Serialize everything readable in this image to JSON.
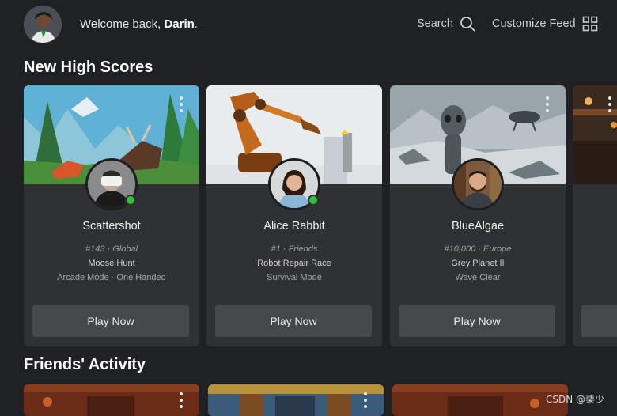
{
  "header": {
    "welcome_prefix": "Welcome back, ",
    "user_name": "Darin",
    "welcome_suffix": ".",
    "search_label": "Search",
    "customize_label": "Customize Feed"
  },
  "sections": {
    "high_scores_title": "New High Scores",
    "friends_activity_title": "Friends' Activity"
  },
  "cards": [
    {
      "player": "Scattershot",
      "rank": "#143 · Global",
      "game": "Moose Hunt",
      "mode": "Arcade Mode · One Handed",
      "button": "Play Now",
      "online": true
    },
    {
      "player": "Alice Rabbit",
      "rank": "#1 · Friends",
      "game": "Robot Repair Race",
      "mode": "Survival Mode",
      "button": "Play Now",
      "online": true
    },
    {
      "player": "BlueAlgae",
      "rank": "#10,000 · Europe",
      "game": "Grey Planet II",
      "mode": "Wave Clear",
      "button": "Play Now",
      "online": false
    }
  ],
  "watermark": "CSDN @栗少",
  "colors": {
    "background": "#202124",
    "card": "#303134",
    "button": "#46484c",
    "online": "#2fc23a"
  }
}
